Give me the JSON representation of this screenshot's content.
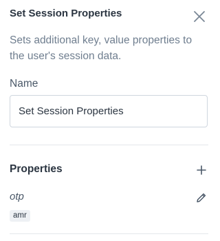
{
  "panel": {
    "title": "Set Session Properties",
    "description": "Sets additional key, value properties to the user's session data."
  },
  "name_field": {
    "label": "Name",
    "value": "Set Session Properties"
  },
  "properties": {
    "title": "Properties",
    "items": [
      {
        "name": "otp",
        "tag": "amr"
      }
    ]
  },
  "icons": {
    "close": "close-icon",
    "add": "plus-icon",
    "edit": "pencil-icon"
  },
  "colors": {
    "title": "#2b3541",
    "muted": "#6f7e8f",
    "border": "#cfd6de",
    "tag_bg": "#eef1f4"
  }
}
